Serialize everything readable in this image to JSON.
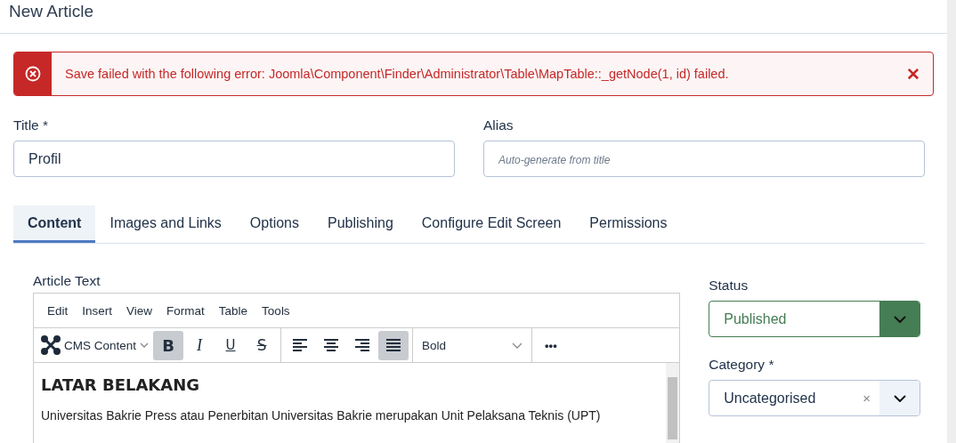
{
  "header": {
    "title": "New Article"
  },
  "alert": {
    "message": "Save failed with the following error: Joomla\\Component\\Finder\\Administrator\\Table\\MapTable::_getNode(1, id) failed.",
    "close": "✕"
  },
  "fields": [
    {
      "label": "Title *",
      "value": "Profil"
    },
    {
      "label": "Alias",
      "placeholder": "Auto-generate from title"
    }
  ],
  "tabs": [
    {
      "label": "Content",
      "selected": true
    },
    {
      "label": "Images and Links",
      "selected": false
    },
    {
      "label": "Options",
      "selected": false
    },
    {
      "label": "Publishing",
      "selected": false
    },
    {
      "label": "Configure Edit Screen",
      "selected": false
    },
    {
      "label": "Permissions",
      "selected": false
    }
  ],
  "editor": {
    "label": "Article Text",
    "menu": [
      "Edit",
      "Insert",
      "View",
      "Format",
      "Table",
      "Tools"
    ],
    "cms_button": "CMS Content",
    "format_buttons": [
      {
        "kind": "bold",
        "label": "B",
        "selected": true
      },
      {
        "kind": "italic",
        "label": "I",
        "selected": false
      },
      {
        "kind": "underline",
        "label": "U",
        "selected": false
      },
      {
        "kind": "strike",
        "label": "S",
        "selected": false
      }
    ],
    "align_buttons": [
      {
        "kind": "left",
        "selected": false
      },
      {
        "kind": "center",
        "selected": false
      },
      {
        "kind": "right",
        "selected": false
      },
      {
        "kind": "justify",
        "selected": true
      }
    ],
    "block_format": "Bold",
    "more": "•••",
    "heading": "LATAR BELAKANG",
    "paragraph": "Universitas Bakrie Press atau Penerbitan Universitas Bakrie merupakan Unit Pelaksana Teknis (UPT)"
  },
  "status": {
    "label": "Status",
    "value": "Published"
  },
  "category": {
    "label": "Category *",
    "value": "Uncategorised",
    "clear": "×"
  }
}
